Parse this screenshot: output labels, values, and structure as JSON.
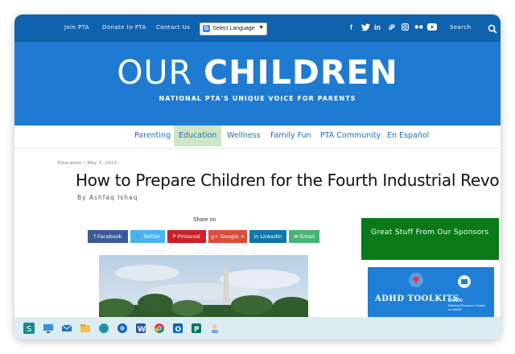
{
  "topbar": {
    "links": [
      "Join PTA",
      "Donate to PTA",
      "Contact Us"
    ],
    "language": "Select Language",
    "social_icons": [
      "facebook-icon",
      "twitter-icon",
      "linkedin-icon",
      "pinterest-icon",
      "instagram-icon",
      "flickr-icon",
      "youtube-icon"
    ],
    "search_label": "Search"
  },
  "hero": {
    "title_thin": "OUR ",
    "title_bold": "CHILDREN",
    "subtitle": "NATIONAL PTA'S UNIQUE VOICE FOR PARENTS"
  },
  "nav": {
    "items": [
      "Parenting",
      "Education",
      "Wellness",
      "Family Fun",
      "PTA Community",
      "En Español"
    ],
    "active": "Education"
  },
  "article": {
    "breadcrumb": "Education / May 7, 2021",
    "title": "How to Prepare Children for the Fourth Industrial Revolution",
    "byline": "By Ashfaq Ishaq",
    "share_label": "Share on",
    "share_buttons": [
      {
        "label": "f Facebook",
        "color": "#3b5998"
      },
      {
        "label": "🐦 Twitter",
        "color": "#4ab3f4"
      },
      {
        "label": "P Pinterest",
        "color": "#cb2027"
      },
      {
        "label": "g+ Google +",
        "color": "#dd4b39"
      },
      {
        "label": "in LinkedIn",
        "color": "#0e76a8"
      },
      {
        "label": "✉ Email",
        "color": "#47b476"
      }
    ]
  },
  "sidebar": {
    "heading": "Great Stuff From Our Sponsors",
    "ad_title": "ADHD TOOLKITS",
    "ad_org": "CHADD",
    "ad_org_sub": "National Resource Center on ADHD"
  },
  "colors": {
    "topbar": "#0f62ad",
    "hero": "#1f7bd1",
    "nav_text": "#1f6fb5",
    "nav_active_bg": "#cfe6c6",
    "sidebar_green": "#0a7a18",
    "taskbar": "#dcecf3"
  },
  "taskbar": {
    "icons": [
      "sway-icon",
      "remote-desktop-icon",
      "mail-icon",
      "file-explorer-icon",
      "edge-icon",
      "edge-dev-icon",
      "word-icon",
      "chrome-icon",
      "outlook-icon",
      "publisher-icon",
      "person-app-icon"
    ]
  }
}
